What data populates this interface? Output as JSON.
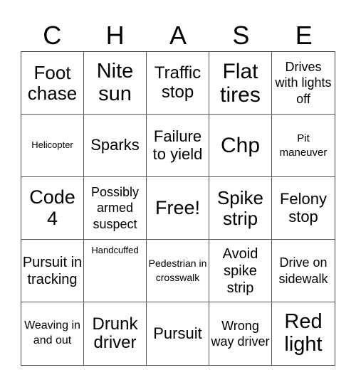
{
  "title_letters": [
    "C",
    "H",
    "A",
    "S",
    "E"
  ],
  "cells": [
    "Foot chase",
    "Nite sun",
    "Traffic stop",
    "Flat tires",
    "Drives with lights off",
    "Helicopter",
    "Sparks",
    "Failure to yield",
    "Chp",
    "Pit maneuver",
    "Code 4",
    "Possibly armed suspect",
    "Free!",
    "Spike strip",
    "Felony stop",
    "Pursuit in tracking",
    "Handcuffed",
    "Pedestrian in crosswalk",
    "Avoid spike strip",
    "Drive on sidewalk",
    "Weaving in and out",
    "Drunk driver",
    "Pursuit",
    "Wrong way driver",
    "Red light"
  ]
}
